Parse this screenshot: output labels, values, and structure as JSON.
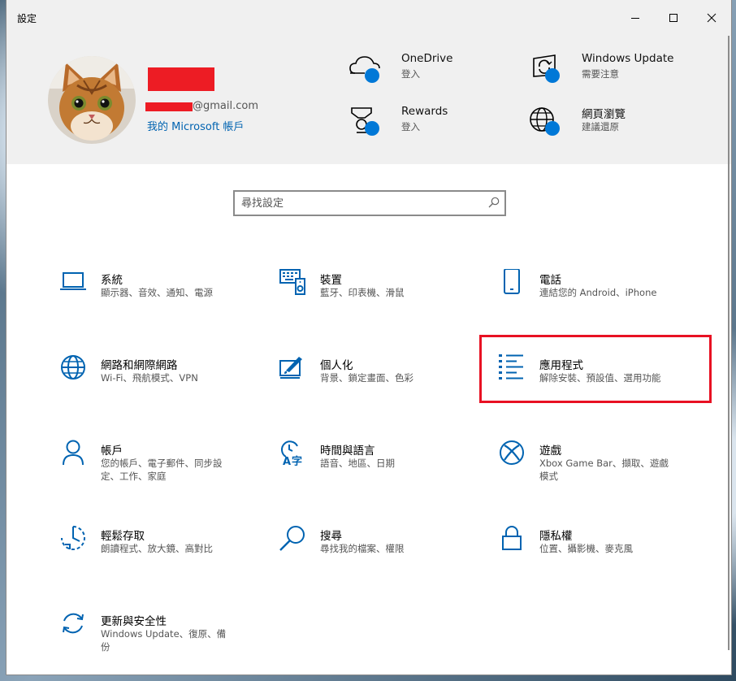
{
  "window": {
    "title": "設定"
  },
  "profile": {
    "email_suffix": "@gmail.com",
    "account_link": "我的 Microsoft 帳戶"
  },
  "quick_links": [
    {
      "title": "OneDrive",
      "subtitle": "登入",
      "icon": "onedrive-icon"
    },
    {
      "title": "Windows Update",
      "subtitle": "需要注意",
      "icon": "windows-update-icon"
    },
    {
      "title": "Rewards",
      "subtitle": "登入",
      "icon": "rewards-icon"
    },
    {
      "title": "網頁瀏覽",
      "subtitle": "建議還原",
      "icon": "web-browsing-icon"
    }
  ],
  "search": {
    "placeholder": "尋找設定"
  },
  "categories": [
    {
      "title": "系統",
      "subtitle": "顯示器、音效、通知、電源",
      "icon": "laptop-icon"
    },
    {
      "title": "裝置",
      "subtitle": "藍牙、印表機、滑鼠",
      "icon": "devices-icon"
    },
    {
      "title": "電話",
      "subtitle": "連結您的 Android、iPhone",
      "icon": "phone-icon"
    },
    {
      "title": "網路和網際網路",
      "subtitle": "Wi-Fi、飛航模式、VPN",
      "icon": "globe-icon"
    },
    {
      "title": "個人化",
      "subtitle": "背景、鎖定畫面、色彩",
      "icon": "personalization-icon"
    },
    {
      "title": "應用程式",
      "subtitle": "解除安裝、預設值、選用功能",
      "icon": "apps-list-icon",
      "highlighted": true
    },
    {
      "title": "帳戶",
      "subtitle": "您的帳戶、電子郵件、同步設定、工作、家庭",
      "icon": "person-icon"
    },
    {
      "title": "時間與語言",
      "subtitle": "語音、地區、日期",
      "icon": "time-language-icon"
    },
    {
      "title": "遊戲",
      "subtitle": "Xbox Game Bar、擷取、遊戲模式",
      "icon": "xbox-icon"
    },
    {
      "title": "輕鬆存取",
      "subtitle": "朗讀程式、放大鏡、高對比",
      "icon": "ease-of-access-icon"
    },
    {
      "title": "搜尋",
      "subtitle": "尋找我的檔案、權限",
      "icon": "search-icon"
    },
    {
      "title": "隱私權",
      "subtitle": "位置、攝影機、麥克風",
      "icon": "lock-icon"
    },
    {
      "title": "更新與安全性",
      "subtitle": "Windows Update、復原、備份",
      "icon": "sync-icon"
    }
  ],
  "colors": {
    "accent": "#0063b1",
    "badge": "#0078d7",
    "highlight": "#e81123",
    "header_bg": "#f0f0f0"
  }
}
